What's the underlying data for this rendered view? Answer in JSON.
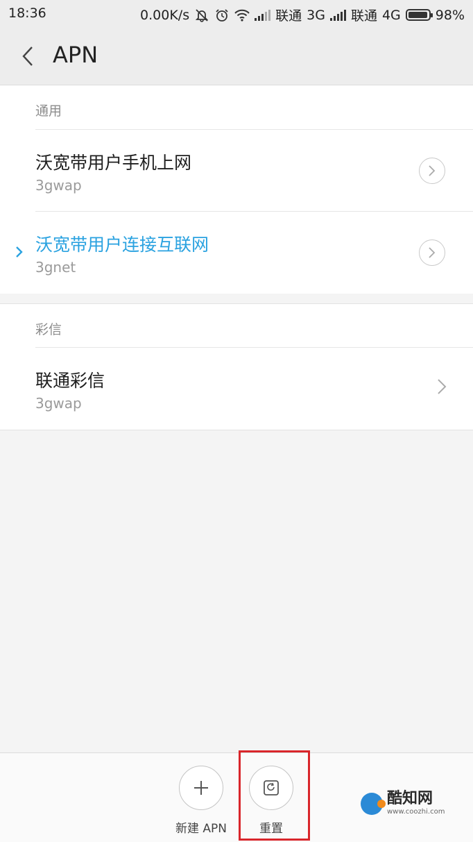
{
  "status_bar": {
    "time": "18:36",
    "speed": "0.00K/s",
    "carrier1": "联通",
    "net1": "3G",
    "carrier2": "联通",
    "net2": "4G",
    "battery": "98%"
  },
  "header": {
    "title": "APN"
  },
  "sections": [
    {
      "header": "通用",
      "items": [
        {
          "name": "沃宽带用户手机上网",
          "apn": "3gwap",
          "selected": false
        },
        {
          "name": "沃宽带用户连接互联网",
          "apn": "3gnet",
          "selected": true
        }
      ]
    },
    {
      "header": "彩信",
      "items": [
        {
          "name": "联通彩信",
          "apn": "3gwap",
          "selected": false
        }
      ]
    }
  ],
  "actions": {
    "new_apn": "新建 APN",
    "reset": "重置"
  },
  "watermark": {
    "brand": "酷知网",
    "url": "www.coozhi.com"
  },
  "colors": {
    "accent": "#2aa2e0",
    "highlight": "#d9262b"
  }
}
